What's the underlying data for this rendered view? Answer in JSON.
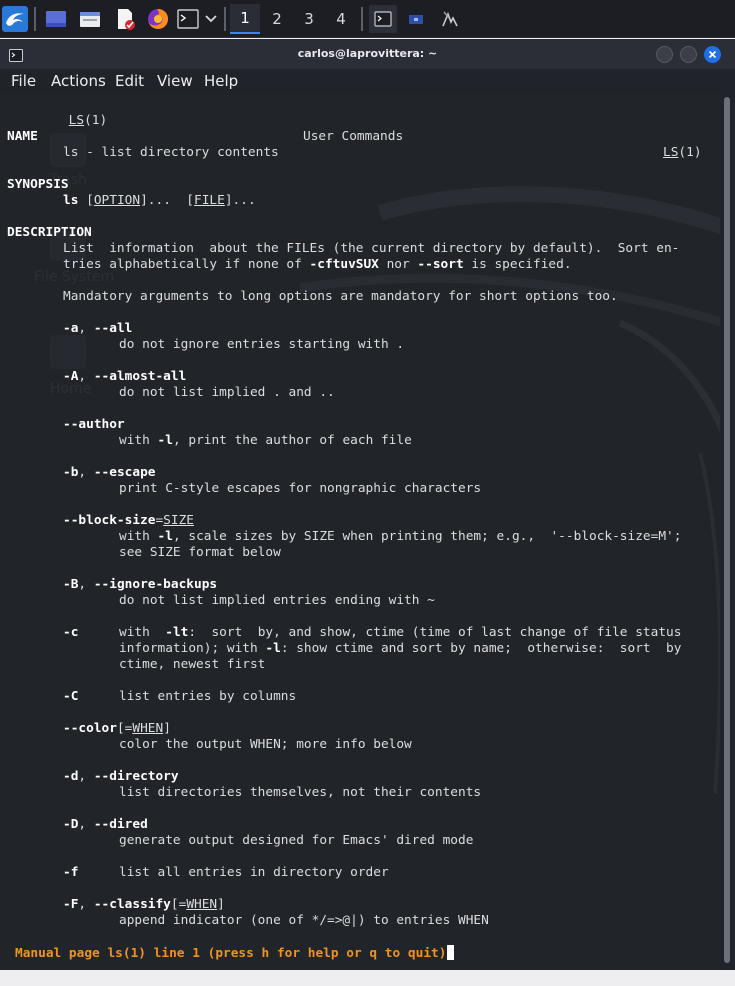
{
  "taskbar": {
    "workspaces": [
      "1",
      "2",
      "3",
      "4"
    ],
    "active_workspace": "1",
    "icons": [
      "kali-menu-icon",
      "desktop-icon",
      "file-manager-icon",
      "text-editor-icon",
      "firefox-icon",
      "terminal-icon",
      "chevron-down-icon",
      "terminal-icon",
      "network-icon",
      "taskmanager-icon"
    ]
  },
  "window": {
    "title": "carlos@laprovittera: ~",
    "menu": [
      "File",
      "Actions",
      "Edit",
      "View",
      "Help"
    ]
  },
  "desktop_ghost_labels": [
    "Trash",
    "File System",
    "Home"
  ],
  "man": {
    "header_left_name": "LS",
    "header_left_section": "(1)",
    "header_center": "User Commands",
    "header_right_name": "LS",
    "header_right_section": "(1)",
    "name_heading": "NAME",
    "name_text": "ls - list directory contents",
    "synopsis_heading": "SYNOPSIS",
    "synopsis_cmd": "ls",
    "synopsis_option": "OPTION",
    "synopsis_file": "FILE",
    "description_heading": "DESCRIPTION",
    "desc_1a": "List  information  about the FILEs (the current directory by default).  Sort en‐",
    "desc_1b_pre": "tries alphabetically if none of ",
    "desc_1b_flags": "-cftuvSUX",
    "desc_1b_mid": " nor ",
    "desc_1b_sort": "--sort",
    "desc_1b_post": " is specified.",
    "desc_2": "Mandatory arguments to long options are mandatory for short options too.",
    "opt_a": "-a",
    "opt_all": "--all",
    "opt_a_desc": "do not ignore entries starting with .",
    "opt_A": "-A",
    "opt_almost_all": "--almost-all",
    "opt_A_desc": "do not list implied . and ..",
    "opt_author": "--author",
    "opt_author_pre": "with ",
    "opt_author_l": "-l",
    "opt_author_post": ", print the author of each file",
    "opt_b": "-b",
    "opt_escape": "--escape",
    "opt_b_desc": "print C-style escapes for nongraphic characters",
    "opt_block": "--block-size",
    "opt_block_arg": "SIZE",
    "opt_block_pre": "with ",
    "opt_block_l": "-l",
    "opt_block_post": ", scale sizes by SIZE when printing them; e.g.,  '--block-size=M';",
    "opt_block_desc2": "see SIZE format below",
    "opt_B": "-B",
    "opt_ignore_backups": "--ignore-backups",
    "opt_B_desc": "do not list implied entries ending with ~",
    "opt_c": "-c",
    "opt_c_pre": "with  ",
    "opt_c_lt": "-lt",
    "opt_c_post": ":  sort  by, and show, ctime (time of last change of file status",
    "opt_c_2pre": "information); with ",
    "opt_c_2l": "-l",
    "opt_c_2post": ": show ctime and sort by name;  otherwise:  sort  by",
    "opt_c_3": "ctime, newest first",
    "opt_C": "-C",
    "opt_C_desc": "list entries by columns",
    "opt_color": "--color",
    "opt_color_arg": "WHEN",
    "opt_color_desc": "color the output WHEN; more info below",
    "opt_d": "-d",
    "opt_directory": "--directory",
    "opt_d_desc": "list directories themselves, not their contents",
    "opt_D": "-D",
    "opt_dired": "--dired",
    "opt_D_desc": "generate output designed for Emacs' dired mode",
    "opt_f": "-f",
    "opt_f_desc": "list all entries in directory order",
    "opt_F": "-F",
    "opt_classify": "--classify",
    "opt_classify_arg": "WHEN",
    "opt_F_desc": "append indicator (one of */=>@|) to entries WHEN",
    "status": "Manual page ls(1) line 1 (press h for help or q to quit)"
  },
  "colors": {
    "background": "#212429",
    "text": "#dcdde0",
    "status": "#f0941e",
    "accent": "#3d87f2",
    "close_button": "#1e6fe8"
  }
}
